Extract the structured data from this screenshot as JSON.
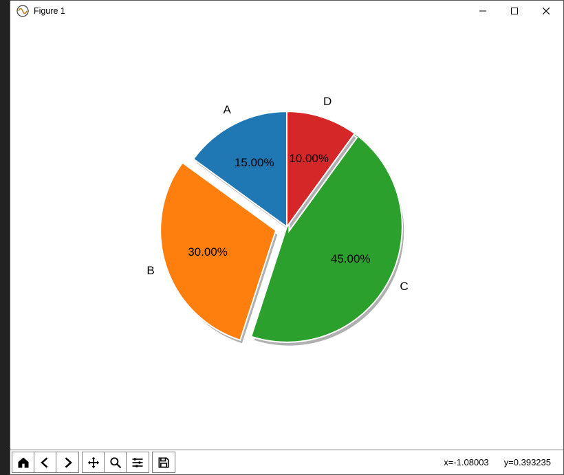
{
  "window": {
    "title": "Figure 1"
  },
  "chart_data": {
    "type": "pie",
    "start_angle": 90,
    "direction": "ccw",
    "series": [
      {
        "name": "A",
        "value": 15,
        "pct_label": "15.00%",
        "color": "#1f77b4",
        "exploded": false
      },
      {
        "name": "B",
        "value": 30,
        "pct_label": "30.00%",
        "color": "#ff7f0e",
        "exploded": true
      },
      {
        "name": "C",
        "value": 45,
        "pct_label": "45.00%",
        "color": "#2ca02c",
        "exploded": false
      },
      {
        "name": "D",
        "value": 10,
        "pct_label": "10.00%",
        "color": "#d62728",
        "exploded": false
      }
    ]
  },
  "toolbar": {
    "home": "Home",
    "back": "Back",
    "forward": "Forward",
    "pan": "Pan",
    "zoom": "Zoom",
    "configure": "Configure subplots",
    "save": "Save"
  },
  "status": {
    "x_label": "x=-1.08003",
    "y_label": "y=0.393235"
  }
}
